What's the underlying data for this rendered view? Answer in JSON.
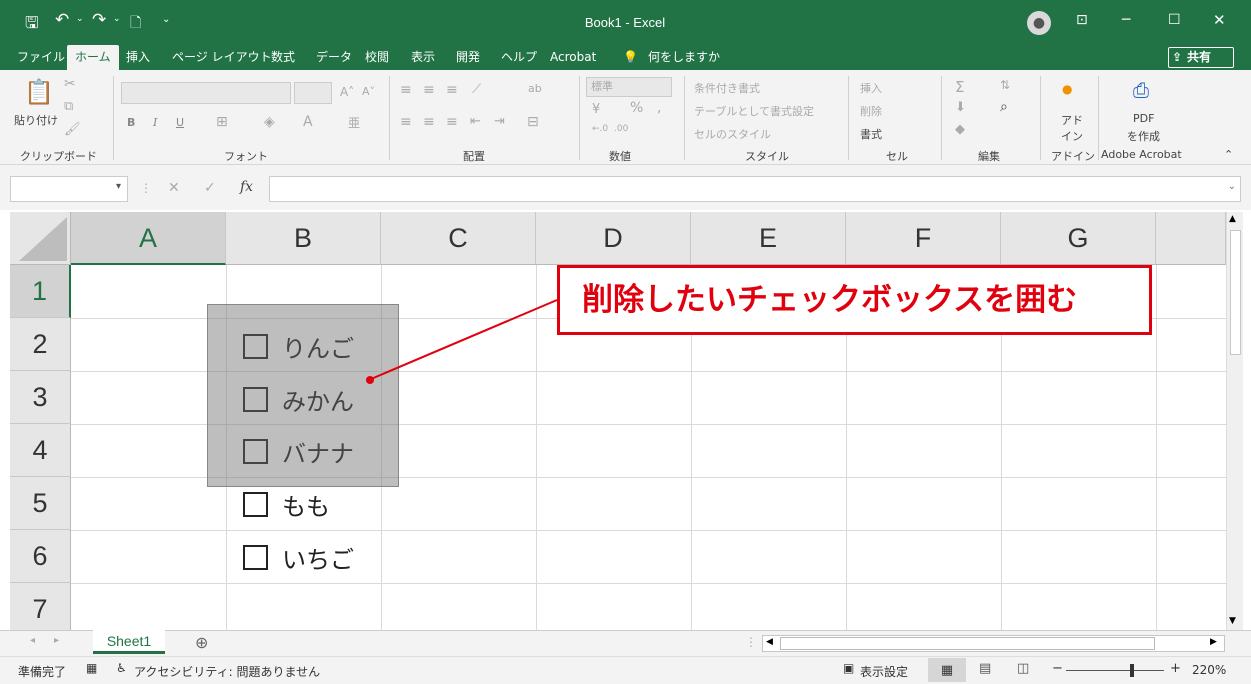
{
  "titlebar": {
    "title": "Book1  -  Excel",
    "minimize_icon": "─",
    "restore_icon": "☐",
    "close_icon": "✕"
  },
  "ribbon_tabs": {
    "file": "ファイル",
    "home": "ホーム",
    "insert": "挿入",
    "page_layout": "ページ レイアウト",
    "formulas": "数式",
    "data": "データ",
    "review": "校閲",
    "view": "表示",
    "developer": "開発",
    "help": "ヘルプ",
    "acrobat": "Acrobat",
    "tell_me": "何をしますか",
    "share": "共有"
  },
  "ribbon": {
    "paste": "貼り付け",
    "clipboard_label": "クリップボード",
    "font_label": "フォント",
    "bold": "B",
    "italic": "I",
    "underline": "U",
    "alignment_label": "配置",
    "number_format": "標準",
    "number_label": "数値",
    "percent": "%",
    "conditional_formatting": "条件付き書式",
    "format_as_table": "テーブルとして書式設定",
    "cell_styles": "セルのスタイル",
    "styles_label": "スタイル",
    "insert_cells": "挿入",
    "delete_cells": "削除",
    "format_cells": "書式",
    "cells_label": "セル",
    "editing_label": "編集",
    "addins_button_line1": "アド",
    "addins_button_line2": "イン",
    "addins_label": "アドイン",
    "pdf_line1": "PDF",
    "pdf_line2": "を作成",
    "acrobat_label": "Adobe Acrobat"
  },
  "formula_bar": {
    "name_box": "",
    "fx": "fx",
    "content": ""
  },
  "grid": {
    "columns": [
      "A",
      "B",
      "C",
      "D",
      "E",
      "F",
      "G"
    ],
    "rows": [
      "1",
      "2",
      "3",
      "4",
      "5",
      "6",
      "7"
    ],
    "checkboxes": [
      "りんご",
      "みかん",
      "バナナ",
      "もも",
      "いちご"
    ]
  },
  "callout": {
    "text": "削除したいチェックボックスを囲む",
    "color": "#e0000e"
  },
  "sheet_tabs": {
    "active": "Sheet1",
    "add": "⊕"
  },
  "status_bar": {
    "ready": "準備完了",
    "accessibility": "アクセシビリティ: 問題ありません",
    "display_settings": "表示設定",
    "zoom_minus": "−",
    "zoom_plus": "+",
    "zoom": "220%"
  },
  "colors": {
    "excel_green": "#217346",
    "ribbon_bg": "#f3f3f3"
  }
}
